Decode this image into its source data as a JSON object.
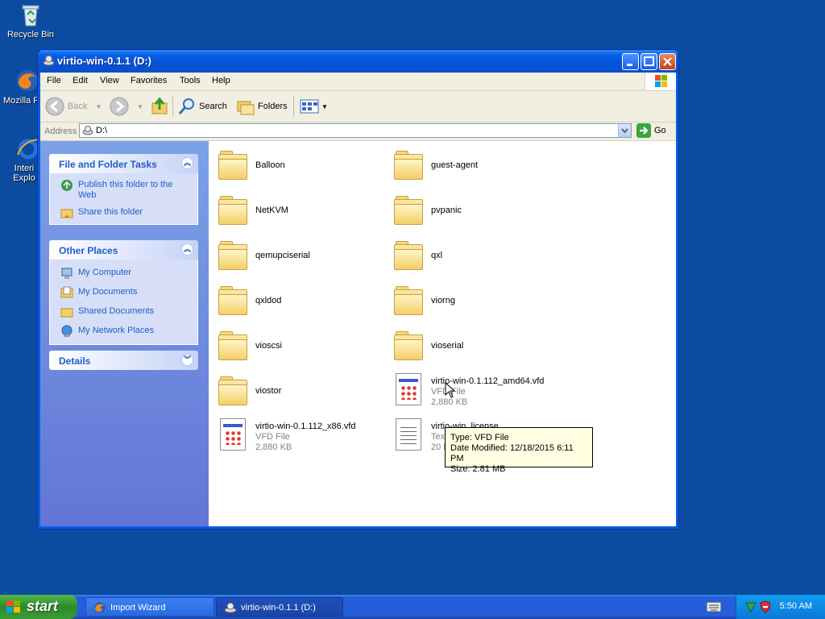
{
  "desktop": {
    "icons": [
      {
        "label": "Recycle Bin"
      },
      {
        "label": "Mozilla F"
      },
      {
        "label": "Interi Explo"
      }
    ]
  },
  "window": {
    "title": "virtio-win-0.1.1 (D:)",
    "menu": [
      "File",
      "Edit",
      "View",
      "Favorites",
      "Tools",
      "Help"
    ],
    "toolbar": {
      "back": "Back",
      "search": "Search",
      "folders": "Folders"
    },
    "address": {
      "label": "Address",
      "value": "D:\\",
      "go": "Go"
    }
  },
  "taskpane": {
    "file_tasks": {
      "title": "File and Folder Tasks",
      "items": [
        "Publish this folder to the Web",
        "Share this folder"
      ]
    },
    "other_places": {
      "title": "Other Places",
      "items": [
        "My Computer",
        "My Documents",
        "Shared Documents",
        "My Network Places"
      ]
    },
    "details": {
      "title": "Details"
    }
  },
  "files": [
    {
      "name": "Balloon",
      "type": "folder"
    },
    {
      "name": "guest-agent",
      "type": "folder"
    },
    {
      "name": "NetKVM",
      "type": "folder"
    },
    {
      "name": "pvpanic",
      "type": "folder"
    },
    {
      "name": "qemupciserial",
      "type": "folder"
    },
    {
      "name": "qxl",
      "type": "folder"
    },
    {
      "name": "qxldod",
      "type": "folder"
    },
    {
      "name": "viorng",
      "type": "folder"
    },
    {
      "name": "vioscsi",
      "type": "folder"
    },
    {
      "name": "vioserial",
      "type": "folder"
    },
    {
      "name": "viostor",
      "type": "folder"
    },
    {
      "name": "virtio-win-0.1.112_amd64.vfd",
      "type": "VFD File",
      "size": "2,880 KB"
    },
    {
      "name": "virtio-win-0.1.112_x86.vfd",
      "type": "VFD File",
      "size": "2,880 KB"
    },
    {
      "name": "virtio-win_license",
      "type": "Tex",
      "size": "20 K"
    }
  ],
  "tooltip": {
    "line1": "Type: VFD File",
    "line2": "Date Modified: 12/18/2015 6:11 PM",
    "line3": "Size: 2.81 MB"
  },
  "taskbar": {
    "start": "start",
    "tasks": [
      "Import Wizard",
      "virtio-win-0.1.1 (D:)"
    ],
    "clock": "5:50 AM"
  }
}
